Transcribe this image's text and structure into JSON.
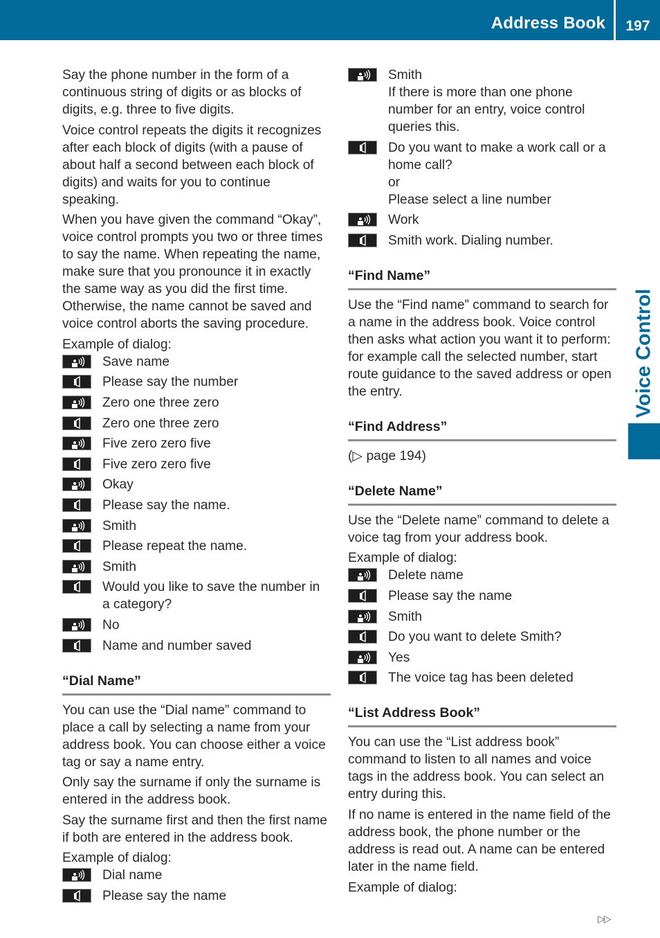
{
  "header": {
    "title": "Address Book",
    "page_number": "197",
    "color": "#006a9b"
  },
  "side_tab": {
    "label": "Voice Control"
  },
  "left_column": {
    "paragraphs": [
      "Say the phone number in the form of a continuous string of digits or as blocks of digits, e.g. three to five digits.",
      "Voice control repeats the digits it recognizes after each block of digits (with a pause of about half a second between each block of digits) and waits for you to continue speaking.",
      "When you have given the command “Okay”, voice control prompts you two or three times to say the name. When repeating the name, make sure that you pronounce it in exactly the same way as you did the first time. Otherwise, the name cannot be saved and voice control aborts the saving procedure.",
      "Example of dialog:"
    ],
    "dialog": [
      {
        "speaker": "user",
        "icon": "user-speaking-icon",
        "text": "Save name"
      },
      {
        "speaker": "system",
        "icon": "speaker-icon",
        "text": "Please say the number"
      },
      {
        "speaker": "user",
        "icon": "user-speaking-icon",
        "text": "Zero one three zero"
      },
      {
        "speaker": "system",
        "icon": "speaker-icon",
        "text": "Zero one three zero"
      },
      {
        "speaker": "user",
        "icon": "user-speaking-icon",
        "text": "Five zero zero five"
      },
      {
        "speaker": "system",
        "icon": "speaker-icon",
        "text": "Five zero zero five"
      },
      {
        "speaker": "user",
        "icon": "user-speaking-icon",
        "text": "Okay"
      },
      {
        "speaker": "system",
        "icon": "speaker-icon",
        "text": "Please say the name."
      },
      {
        "speaker": "user",
        "icon": "user-speaking-icon",
        "text": "Smith"
      },
      {
        "speaker": "system",
        "icon": "speaker-icon",
        "text": "Please repeat the name."
      },
      {
        "speaker": "user",
        "icon": "user-speaking-icon",
        "text": "Smith"
      },
      {
        "speaker": "system",
        "icon": "speaker-icon",
        "text": "Would you like to save the number in a category?"
      },
      {
        "speaker": "user",
        "icon": "user-speaking-icon",
        "text": "No"
      },
      {
        "speaker": "system",
        "icon": "speaker-icon",
        "text": "Name and number saved"
      }
    ],
    "dial_name": {
      "heading": "“Dial Name”",
      "paragraphs": [
        "You can use the “Dial name” command to place a call by selecting a name from your address book. You can choose either a voice tag or say a name entry.",
        "Only say the surname if only the surname is entered in the address book.",
        "Say the surname first and then the first name if both are entered in the address book.",
        "Example of dialog:"
      ],
      "dialog": [
        {
          "speaker": "user",
          "icon": "user-speaking-icon",
          "text": "Dial name"
        },
        {
          "speaker": "system",
          "icon": "speaker-icon",
          "text": "Please say the name"
        }
      ]
    }
  },
  "right_column": {
    "dialog_continued": [
      {
        "speaker": "user",
        "icon": "user-speaking-icon",
        "text": "Smith",
        "note": "If there is more than one phone number for an entry, voice control queries this."
      },
      {
        "speaker": "system",
        "icon": "speaker-icon",
        "text": "Do you want to make a work call or a home call?",
        "or": "or",
        "alt": "Please select a line number"
      },
      {
        "speaker": "user",
        "icon": "user-speaking-icon",
        "text": "Work"
      },
      {
        "speaker": "system",
        "icon": "speaker-icon",
        "text": "Smith work. Dialing number."
      }
    ],
    "find_name": {
      "heading": "“Find Name”",
      "paragraph": "Use the “Find name” command to search for a name in the address book. Voice control then asks what action you want it to perform: for example call the selected number, start route guidance to the saved address or open the entry."
    },
    "find_address": {
      "heading": "“Find Address”",
      "reference_prefix": "(",
      "reference_arrow": "▷",
      "reference_text": " page 194)"
    },
    "delete_name": {
      "heading": "“Delete Name”",
      "paragraphs": [
        "Use the “Delete name” command to delete a voice tag from your address book.",
        "Example of dialog:"
      ],
      "dialog": [
        {
          "speaker": "user",
          "icon": "user-speaking-icon",
          "text": "Delete name"
        },
        {
          "speaker": "system",
          "icon": "speaker-icon",
          "text": "Please say the name"
        },
        {
          "speaker": "user",
          "icon": "user-speaking-icon",
          "text": "Smith"
        },
        {
          "speaker": "system",
          "icon": "speaker-icon",
          "text": "Do you want to delete Smith?"
        },
        {
          "speaker": "user",
          "icon": "user-speaking-icon",
          "text": "Yes"
        },
        {
          "speaker": "system",
          "icon": "speaker-icon",
          "text": "The voice tag has been deleted"
        }
      ]
    },
    "list_address_book": {
      "heading": "“List Address Book”",
      "paragraphs": [
        "You can use the “List address book” command to listen to all names and voice tags in the address book. You can select an entry during this.",
        "If no name is entered in the name field of the address book, the phone number or the address is read out. A name can be entered later in the name field.",
        "Example of dialog:"
      ]
    }
  },
  "footer": {
    "continue_marker": "▷▷"
  }
}
